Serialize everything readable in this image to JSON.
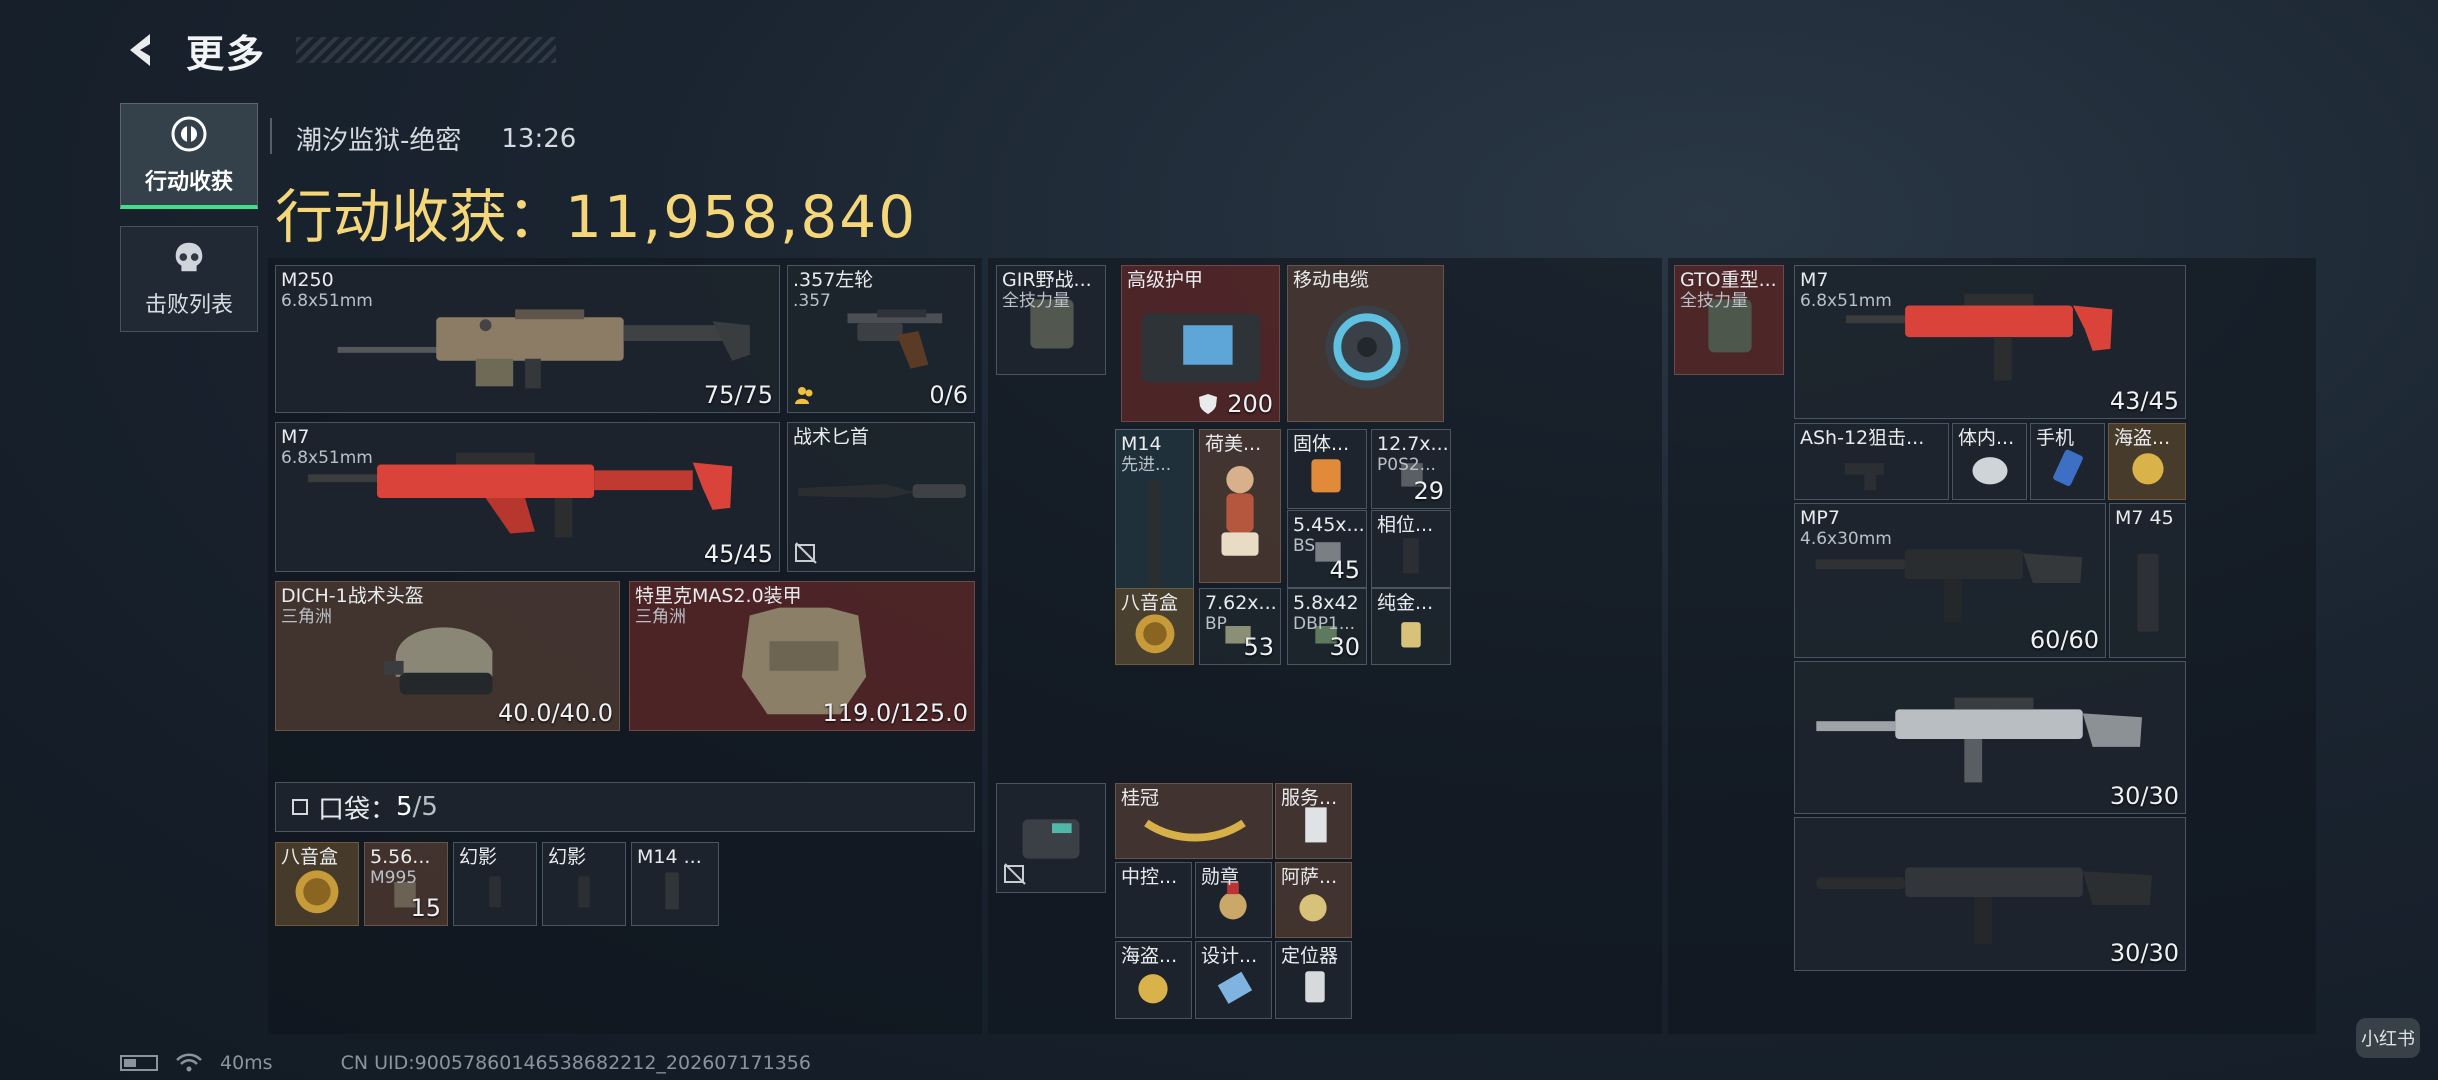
{
  "header": {
    "back_icon": "chevron-left-icon",
    "title": "更多"
  },
  "side_tabs": [
    {
      "label": "行动收获",
      "icon": "target-icon",
      "active": true
    },
    {
      "label": "击败列表",
      "icon": "skull-icon",
      "active": false
    }
  ],
  "match": {
    "map": "潮汐监狱-绝密",
    "time": "13:26"
  },
  "earnings": {
    "label": "行动收获：",
    "value": "11,958,840"
  },
  "loadout": {
    "primary": {
      "name": "M250",
      "ammo": "6.8x51mm",
      "count": "75/75"
    },
    "pistol": {
      "name": ".357左轮",
      "ammo": ".357",
      "count": "0/6"
    },
    "secondary": {
      "name": "M7",
      "ammo": "6.8x51mm",
      "count": "45/45"
    },
    "melee": {
      "name": "战术匕首"
    },
    "helmet": {
      "name": "DICH-1战术头盔",
      "origin": "三角洲",
      "durability": "40.0/40.0"
    },
    "armor": {
      "name": "特里克MAS2.0装甲",
      "origin": "三角洲",
      "durability": "119.0/125.0"
    }
  },
  "pocket": {
    "label": "口袋：",
    "used": "5",
    "total": "/5",
    "items": [
      {
        "name": "八音盒",
        "sub": "",
        "count": ""
      },
      {
        "name": "5.56...",
        "sub": "M995",
        "count": "15"
      },
      {
        "name": "幻影",
        "sub": "",
        "count": ""
      },
      {
        "name": "幻影",
        "sub": "",
        "count": ""
      },
      {
        "name": "M14 ...",
        "sub": "",
        "count": ""
      }
    ]
  },
  "rig": {
    "name": "GIR野战...",
    "sub": "全技力量",
    "items": [
      {
        "name": "高级护甲",
        "count": "200"
      },
      {
        "name": "移动电缆",
        "count": ""
      },
      {
        "name": "M14",
        "sub": "先进...",
        "count": ""
      },
      {
        "name": "荷美...",
        "count": ""
      },
      {
        "name": "固体...",
        "count": ""
      },
      {
        "name": "12.7x...",
        "sub": "P0S2...",
        "count": "29"
      },
      {
        "name": "5.45x...",
        "sub": "BS",
        "count": "45"
      },
      {
        "name": "相位...",
        "count": ""
      },
      {
        "name": "八音盒",
        "count": ""
      },
      {
        "name": "7.62x...",
        "sub": "BP",
        "count": "53"
      },
      {
        "name": "5.8x42",
        "sub": "DBP1...",
        "count": "30"
      },
      {
        "name": "纯金...",
        "count": ""
      }
    ]
  },
  "bag": {
    "items": [
      {
        "name": "桂冠"
      },
      {
        "name": "服务..."
      },
      {
        "name": "中控..."
      },
      {
        "name": "勋章"
      },
      {
        "name": "阿萨..."
      },
      {
        "name": "海盗..."
      },
      {
        "name": "设计..."
      },
      {
        "name": "定位器"
      }
    ]
  },
  "safebox": {
    "name": "GTO重型...",
    "sub": "全技力量",
    "items": [
      {
        "name": "M7",
        "sub": "6.8x51mm",
        "count": "43/45"
      },
      {
        "name": "ASh-12狙击..."
      },
      {
        "name": "体内..."
      },
      {
        "name": "手机"
      },
      {
        "name": "海盗..."
      },
      {
        "name": "MP7",
        "sub": "4.6x30mm",
        "count": "60/60"
      },
      {
        "name": "M7 45"
      },
      {
        "name": "",
        "count": "30/30"
      },
      {
        "name": "",
        "count": "30/30"
      }
    ]
  },
  "footer": {
    "ping": "40ms",
    "uid": "CN UID:9005786014653868221​2_202607171356"
  },
  "watermark": "小红书",
  "colors": {
    "accent_gold": "#f5d77a",
    "active_green": "#3fe08a",
    "red_skin": "#d9433a"
  }
}
